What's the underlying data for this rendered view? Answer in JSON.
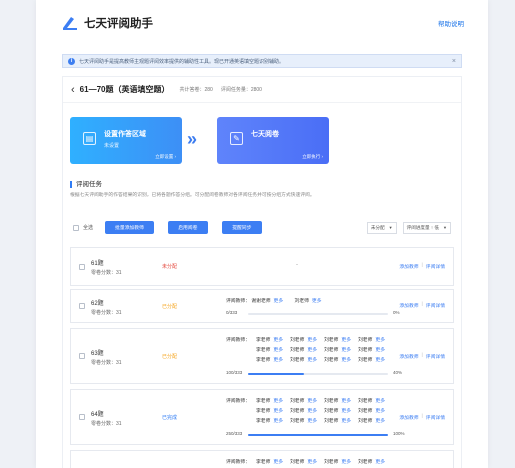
{
  "header": {
    "app_name": "七天评阅助手",
    "help_label": "帮助说明"
  },
  "notice": {
    "text": "七天评阅助手是提高教师主观题评阅效率提供的辅助性工具。现已开通英语填空题识别辅助。",
    "close_icon": "close-icon"
  },
  "task": {
    "title": "61—70题（英语填空题）",
    "total_papers": "共计答卷：280",
    "review_tasks": "评阅任务量：2800"
  },
  "steps": [
    {
      "name": "设置作答区域",
      "sub": "未设置",
      "link": "立即设置 ›",
      "icon": "layout-icon"
    },
    {
      "name": "七天阅卷",
      "sub": "",
      "link": "立即执行 ›",
      "icon": "edit-icon"
    }
  ],
  "section": {
    "title": "评阅任务",
    "desc": "根据七天评阅助手的作答结果的识别，已将各题作答分组。可分配阅卷教师对各评阅任务并可按分组方式快速评阅。"
  },
  "toolbar": {
    "select_all": "全选",
    "batch_assign": "批量添加教师",
    "enable_review": "启用阅卷",
    "sync_progress": "提醒同步",
    "filter_status": "未分配",
    "sort_by": "评阅进度量 ↑ 低"
  },
  "rows": [
    {
      "q": "61题",
      "score": "零卷分数：31",
      "status": "未分配",
      "status_color": "#e4453a",
      "ops": [
        "添加教师",
        "评阅详情"
      ],
      "dash": "-"
    },
    {
      "q": "62题",
      "score": "零卷分数：31",
      "status": "已分配",
      "status_color": "#f5a31a",
      "ops": [
        "添加教师",
        "评阅详情"
      ],
      "assign_label": "评阅教师：",
      "teachers": [
        [
          "谢谢老师",
          "更多"
        ],
        [
          "刘老师",
          "更多"
        ]
      ],
      "progress_text": "0/333",
      "progress": 0,
      "pct": "0%"
    },
    {
      "q": "63题",
      "score": "零卷分数：31",
      "status": "已分配",
      "status_color": "#f5a31a",
      "ops": [
        "添加教师",
        "评阅详情"
      ],
      "assign_label": "评阅教师：",
      "grid": [
        [
          "李老师",
          "更多"
        ],
        [
          "刘老师",
          "更多"
        ],
        [
          "刘老师",
          "更多"
        ],
        [
          "刘老师",
          "更多"
        ],
        [
          "李老师",
          "更多"
        ],
        [
          "刘老师",
          "更多"
        ],
        [
          "刘老师",
          "更多"
        ],
        [
          "刘老师",
          "更多"
        ],
        [
          "李老师",
          "更多"
        ],
        [
          "刘老师",
          "更多"
        ],
        [
          "刘老师",
          "更多"
        ],
        [
          "刘老师",
          "更多"
        ]
      ],
      "progress_text": "100/333",
      "progress": 0.4,
      "pct": "40%"
    },
    {
      "q": "64题",
      "score": "零卷分数：31",
      "status": "已完成",
      "status_color": "#2f7cf5",
      "ops": [
        "添加教师",
        "评阅详情"
      ],
      "assign_label": "评阅教师：",
      "grid": [
        [
          "李老师",
          "更多"
        ],
        [
          "刘老师",
          "更多"
        ],
        [
          "刘老师",
          "更多"
        ],
        [
          "刘老师",
          "更多"
        ],
        [
          "李老师",
          "更多"
        ],
        [
          "刘老师",
          "更多"
        ],
        [
          "刘老师",
          "更多"
        ],
        [
          "刘老师",
          "更多"
        ],
        [
          "李老师",
          "更多"
        ],
        [
          "刘老师",
          "更多"
        ],
        [
          "刘老师",
          "更多"
        ],
        [
          "刘老师",
          "更多"
        ]
      ],
      "progress_text": "250/333",
      "progress": 1,
      "pct": "100%"
    },
    {
      "assign_label": "评阅教师：",
      "grid": [
        [
          "李老师",
          "更多"
        ],
        [
          "刘老师",
          "更多"
        ],
        [
          "刘老师",
          "更多"
        ],
        [
          "刘老师",
          "更多"
        ]
      ]
    }
  ]
}
